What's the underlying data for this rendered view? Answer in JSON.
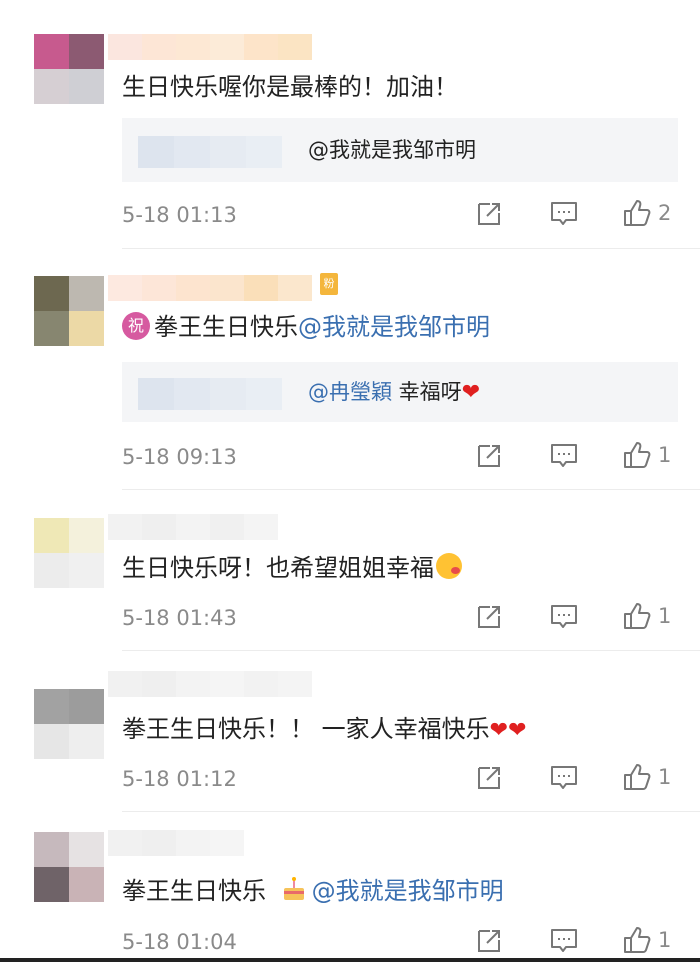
{
  "comments": [
    {
      "text": "生日快乐喔你是最棒的！加油！",
      "reply_mention": "@我就是我邹市明",
      "time": "5-18 01:13",
      "likes": "2"
    },
    {
      "zhu_label": "祝",
      "text": "拳王生日快乐",
      "mention": "@我就是我邹市明",
      "reply_mention": "@冉瑩穎",
      "reply_text": " 幸福呀",
      "heart": "❤",
      "time": "5-18 09:13",
      "likes": "1"
    },
    {
      "text": "生日快乐呀！也希望姐姐幸福",
      "time": "5-18 01:43",
      "likes": "1"
    },
    {
      "text": "拳王生日快乐！！ 一家人幸福快乐",
      "hearts": "❤❤",
      "time": "5-18 01:12",
      "likes": "1"
    },
    {
      "text": "拳王生日快乐 ",
      "mention": "@我就是我邹市明",
      "time": "5-18 01:04",
      "likes": "1"
    }
  ],
  "icons": [
    "share-icon",
    "comment-icon",
    "like-icon",
    "cake-icon",
    "heart-icon"
  ],
  "colors": {
    "mention": "#3a6fb0",
    "time": "#8a8a8a",
    "reply_bg": "#f4f5f7"
  }
}
